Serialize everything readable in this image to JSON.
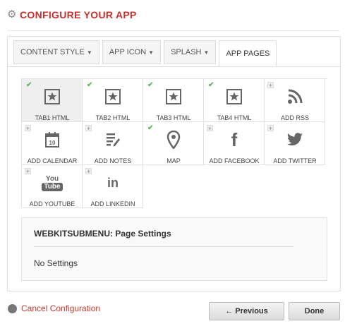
{
  "header": {
    "title": "CONFIGURE YOUR APP",
    "icon": "gear-icon"
  },
  "tabs": [
    {
      "label": "CONTENT STYLE",
      "chevron": true,
      "active": false
    },
    {
      "label": "APP ICON",
      "chevron": true,
      "active": false
    },
    {
      "label": "SPLASH",
      "chevron": true,
      "active": false
    },
    {
      "label": "APP PAGES",
      "chevron": false,
      "active": true
    }
  ],
  "pages": [
    {
      "label": "TAB1 HTML",
      "icon": "star-box-icon",
      "added": true,
      "selected": true
    },
    {
      "label": "TAB2 HTML",
      "icon": "star-box-icon",
      "added": true,
      "selected": false
    },
    {
      "label": "TAB3 HTML",
      "icon": "star-box-icon",
      "added": true,
      "selected": false
    },
    {
      "label": "TAB4 HTML",
      "icon": "star-box-icon",
      "added": true,
      "selected": false
    },
    {
      "label": "ADD RSS",
      "icon": "rss-icon",
      "added": false,
      "selected": false
    },
    {
      "label": "ADD CALENDAR",
      "icon": "calendar-icon",
      "added": false,
      "selected": false
    },
    {
      "label": "ADD NOTES",
      "icon": "notes-icon",
      "added": false,
      "selected": false
    },
    {
      "label": "MAP",
      "icon": "map-pin-icon",
      "added": true,
      "selected": false
    },
    {
      "label": "ADD FACEBOOK",
      "icon": "facebook-icon",
      "added": false,
      "selected": false
    },
    {
      "label": "ADD TWITTER",
      "icon": "twitter-icon",
      "added": false,
      "selected": false
    },
    {
      "label": "ADD YOUTUBE",
      "icon": "youtube-icon",
      "added": false,
      "selected": false
    },
    {
      "label": "ADD LINKEDIN",
      "icon": "linkedin-icon",
      "added": false,
      "selected": false
    }
  ],
  "calendar_day": "10",
  "youtube_top": "You",
  "youtube_bottom": "Tube",
  "linkedin_text": "in",
  "facebook_text": "f",
  "settings": {
    "title": "WEBKITSUBMENU: Page Settings",
    "text": "No Settings"
  },
  "footer": {
    "cancel_label": "Cancel Configuration",
    "previous_label": "← Previous",
    "done_label": "Done"
  },
  "colors": {
    "accent": "#c9302c",
    "check": "#5cb85c"
  }
}
